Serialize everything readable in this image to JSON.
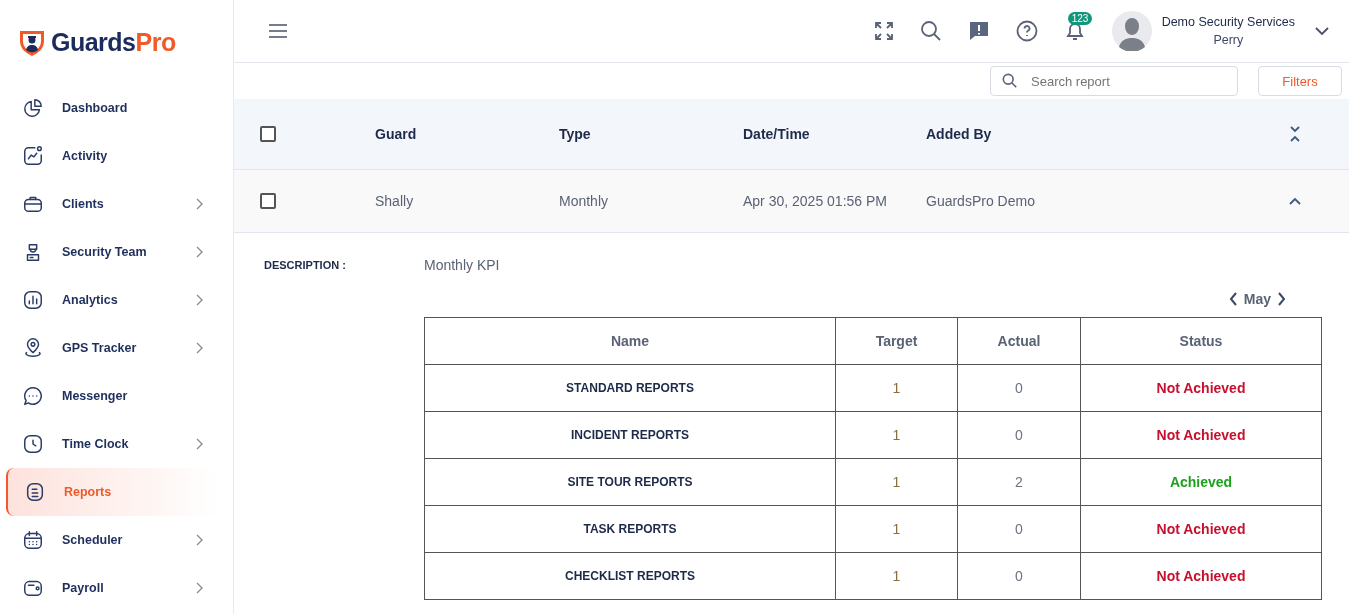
{
  "logo": {
    "main": "Guards",
    "accent": "Pro"
  },
  "sidebar": {
    "items": [
      {
        "label": "Dashboard",
        "selected": false,
        "has_submenu": false
      },
      {
        "label": "Activity",
        "selected": false,
        "has_submenu": false
      },
      {
        "label": "Clients",
        "selected": false,
        "has_submenu": true
      },
      {
        "label": "Security Team",
        "selected": false,
        "has_submenu": true
      },
      {
        "label": "Analytics",
        "selected": false,
        "has_submenu": true
      },
      {
        "label": "GPS Tracker",
        "selected": false,
        "has_submenu": true
      },
      {
        "label": "Messenger",
        "selected": false,
        "has_submenu": false
      },
      {
        "label": "Time Clock",
        "selected": false,
        "has_submenu": true
      },
      {
        "label": "Reports",
        "selected": true,
        "has_submenu": false
      },
      {
        "label": "Scheduler",
        "selected": false,
        "has_submenu": true
      },
      {
        "label": "Payroll",
        "selected": false,
        "has_submenu": true
      }
    ]
  },
  "header": {
    "notification_count": "123",
    "user": {
      "company": "Demo Security Services",
      "name": "Perry"
    }
  },
  "toolbar": {
    "search": {
      "placeholder": "Search report"
    },
    "filters": "Filters"
  },
  "table": {
    "select_all_checked": false,
    "columns": [
      "Guard",
      "Type",
      "Date/Time",
      "Added By"
    ],
    "rows": [
      {
        "checked": false,
        "expanded": true,
        "guard": "Shally",
        "type": "Monthly",
        "datetime": "Apr 30, 2025 01:56 PM",
        "added_by": "GuardsPro Demo"
      }
    ]
  },
  "detail": {
    "description_label": "DESCRIPTION :",
    "description": "Monthly KPI",
    "month": "May",
    "kpi_columns": [
      "Name",
      "Target",
      "Actual",
      "Status"
    ],
    "kpi_rows": [
      {
        "name": "STANDARD REPORTS",
        "target": "1",
        "actual": "0",
        "status": "Not Achieved",
        "achieved": false
      },
      {
        "name": "INCIDENT REPORTS",
        "target": "1",
        "actual": "0",
        "status": "Not Achieved",
        "achieved": false
      },
      {
        "name": "SITE TOUR REPORTS",
        "target": "1",
        "actual": "2",
        "status": "Achieved",
        "achieved": true
      },
      {
        "name": "TASK REPORTS",
        "target": "1",
        "actual": "0",
        "status": "Not Achieved",
        "achieved": false
      },
      {
        "name": "CHECKLIST REPORTS",
        "target": "1",
        "actual": "0",
        "status": "Not Achieved",
        "achieved": false
      }
    ]
  }
}
